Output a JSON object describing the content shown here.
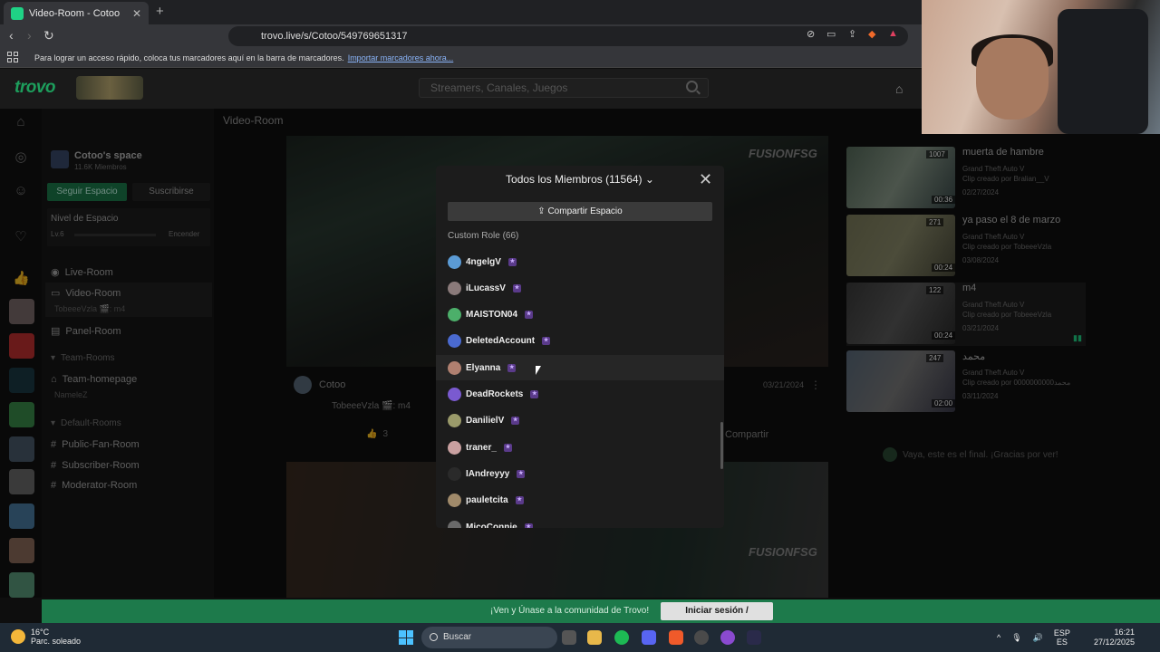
{
  "browser": {
    "tab_title": "Video-Room - Cotoo",
    "url": "trovo.live/s/Cotoo/549769651317",
    "bookmarks_msg": "Para lograr un acceso rápido, coloca tus marcadores aquí en la barra de marcadores.",
    "bookmarks_link": "Importar marcadores ahora..."
  },
  "header": {
    "logo": "trovo",
    "search_placeholder": "Streamers, Canales, Juegos"
  },
  "space": {
    "name": "Cotoo's space",
    "members": "11.6K Miembros",
    "follow_label": "Seguir Espacio",
    "subscribe_label": "Suscribirse",
    "level_title": "Nivel de Espacio",
    "level": "Lv.6",
    "level_action": "Encender"
  },
  "nav": {
    "live_room": "Live-Room",
    "video_room": "Video-Room",
    "video_room_sub": "TobeeeVzla 🎬: m4",
    "panel_room": "Panel-Room",
    "team_rooms": "Team-Rooms",
    "team_homepage": "Team-homepage",
    "team_homepage_sub": "NameleZ",
    "default_rooms": "Default-Rooms",
    "public_fan_room": "Public-Fan-Room",
    "subscriber_room": "Subscriber-Room",
    "moderator_room": "Moderator-Room"
  },
  "main": {
    "room_title": "Video-Room",
    "author": "Cotoo",
    "post_sub": "TobeeeVzla 🎬: m4",
    "date": "03/21/2024",
    "likes": "3",
    "share": "Compartir"
  },
  "modal": {
    "title": "Todos los Miembros (11564)",
    "share_label": "Compartir Espacio",
    "role_label": "Custom Role (66)",
    "members": [
      {
        "name": "4ngelgV",
        "color": "#5b9bd5"
      },
      {
        "name": "iLucassV",
        "color": "#8a7a7a"
      },
      {
        "name": "MAISTON04",
        "color": "#4caf6a"
      },
      {
        "name": "DeletedAccount",
        "color": "#4a6ad0"
      },
      {
        "name": "Elyanna",
        "color": "#b08070"
      },
      {
        "name": "DeadRockets",
        "color": "#7a5ad0"
      },
      {
        "name": "DanilielV",
        "color": "#9a9a6a"
      },
      {
        "name": "traner_",
        "color": "#c9a0a0"
      },
      {
        "name": "IAndreyyy",
        "color": "#2a2a2a"
      },
      {
        "name": "pauletcita",
        "color": "#a08a6a"
      },
      {
        "name": "MicoConnie",
        "color": "#6a6a6a"
      }
    ]
  },
  "clips": [
    {
      "title": "muerta de hambre",
      "game": "Grand Theft Auto V",
      "by": "Clip creado por Bralian__V",
      "date": "02/27/2024",
      "views": "1007",
      "duration": "00:36"
    },
    {
      "title": "ya paso el 8 de marzo",
      "game": "Grand Theft Auto V",
      "by": "Clip creado por TobeeeVzla",
      "date": "03/08/2024",
      "views": "271",
      "duration": "00:24"
    },
    {
      "title": "m4",
      "game": "Grand Theft Auto V",
      "by": "Clip creado por TobeeeVzla",
      "date": "03/21/2024",
      "views": "122",
      "duration": "00:24"
    },
    {
      "title": "محمد",
      "game": "Grand Theft Auto V",
      "by": "Clip creado por 0000000000محمد",
      "date": "03/11/2024",
      "views": "247",
      "duration": "02:00"
    }
  ],
  "end_msg": "Vaya, este es el final. ¡Gracias por ver!",
  "login_bar": {
    "msg": "¡Ven y Únase a la comunidad de Trovo!",
    "button": "Iniciar sesión / Registrarse"
  },
  "taskbar": {
    "temp": "16°C",
    "weather": "Parc. soleado",
    "search": "Buscar",
    "lang1": "ESP",
    "lang2": "ES",
    "time": "16:21",
    "date": "27/12/2025"
  }
}
